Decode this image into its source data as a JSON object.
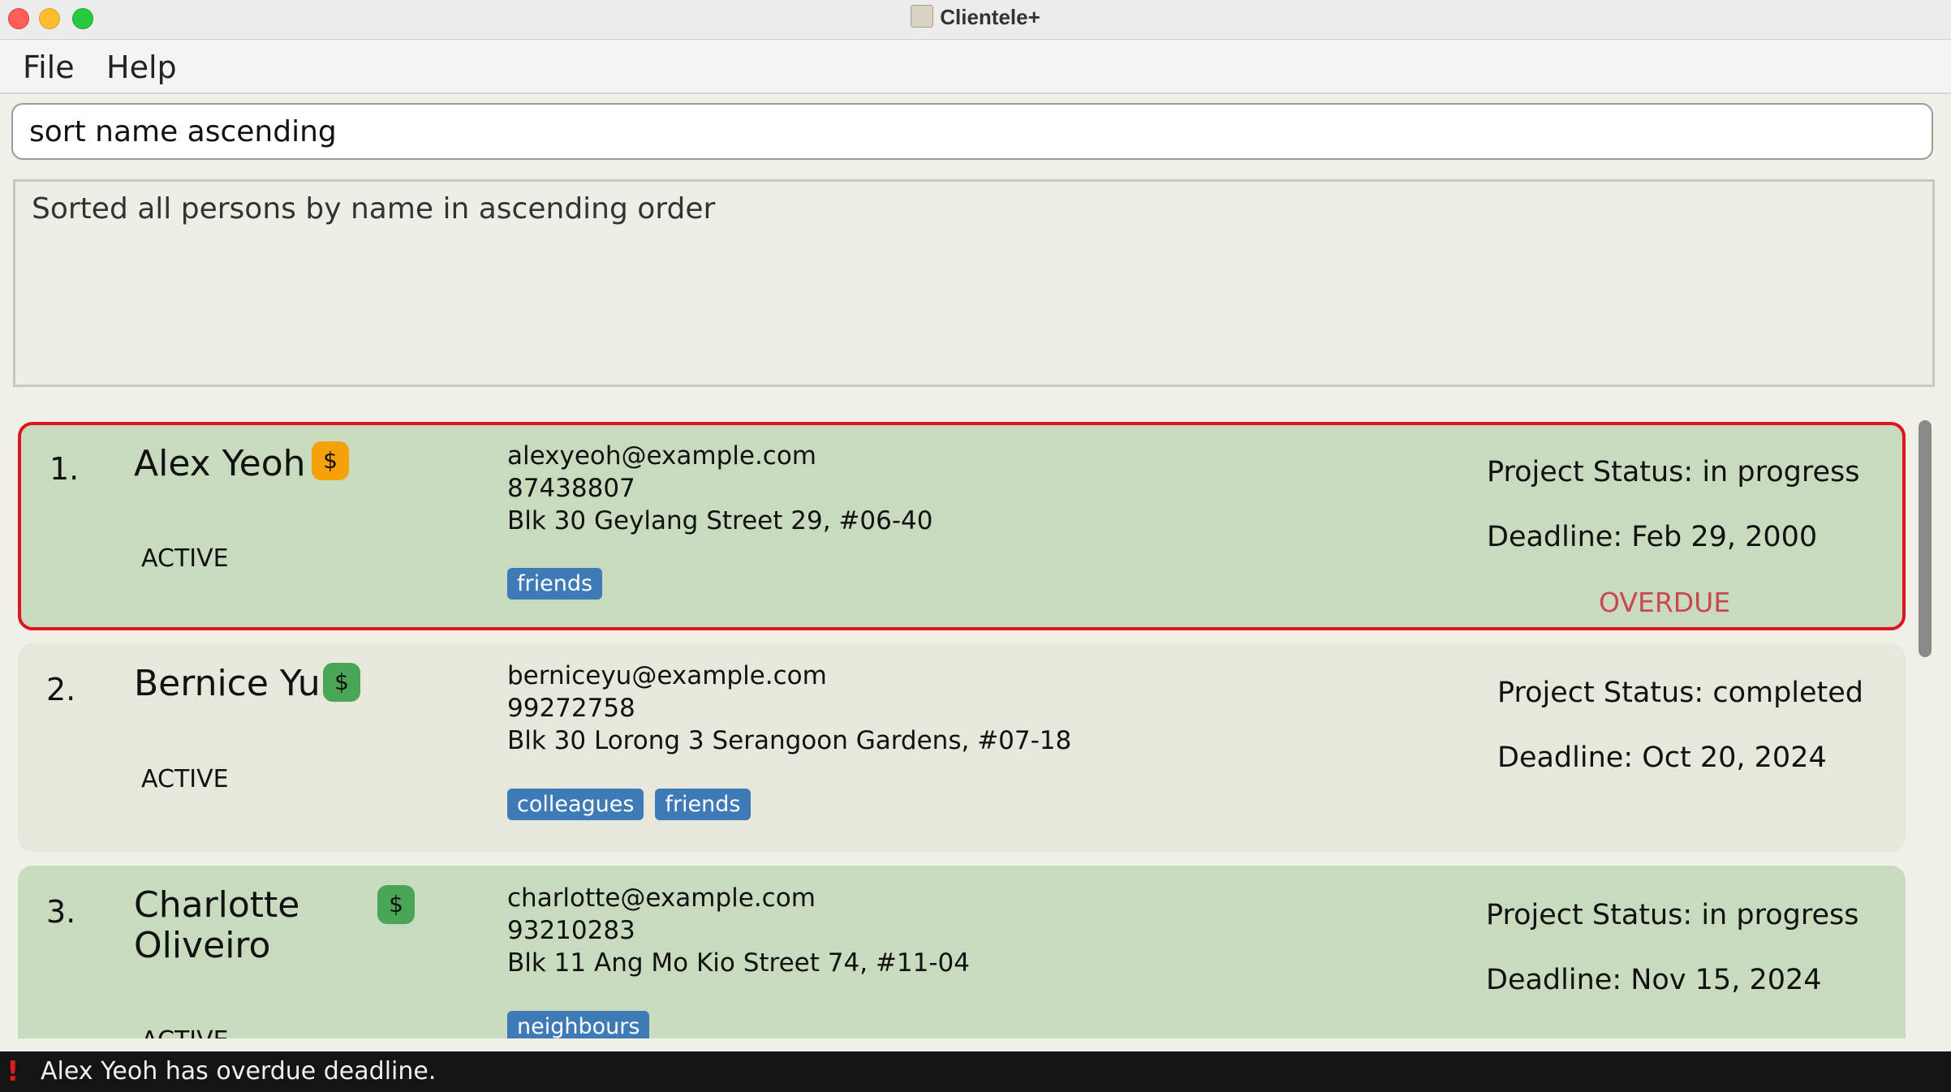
{
  "window": {
    "title": "Clientele+",
    "icon": "address-book-icon"
  },
  "menu": {
    "items": [
      "File",
      "Help"
    ]
  },
  "command": {
    "value": "sort name ascending"
  },
  "result": {
    "text": "Sorted all persons by name in ascending order"
  },
  "persons": [
    {
      "index": "1.",
      "name": "Alex Yeoh",
      "payment_icon": "dollar-icon",
      "payment_color": "#f5a20a",
      "status": "ACTIVE",
      "email": "alexyeoh@example.com",
      "phone": "87438807",
      "address": "Blk 30 Geylang Street 29, #06-40",
      "tags": [
        "friends"
      ],
      "project_status": "Project Status: in progress",
      "deadline": "Deadline: Feb 29, 2000",
      "overdue": "OVERDUE"
    },
    {
      "index": "2.",
      "name": "Bernice Yu",
      "payment_icon": "dollar-icon",
      "payment_color": "#4aa657",
      "status": "ACTIVE",
      "email": "berniceyu@example.com",
      "phone": "99272758",
      "address": "Blk 30 Lorong 3 Serangoon Gardens, #07-18",
      "tags": [
        "colleagues",
        "friends"
      ],
      "project_status": "Project Status: completed",
      "deadline": "Deadline: Oct 20, 2024"
    },
    {
      "index": "3.",
      "name_line1": "Charlotte",
      "name_line2": "Oliveiro",
      "payment_icon": "dollar-icon",
      "payment_color": "#4aa657",
      "status": "ACTIVE",
      "email": "charlotte@example.com",
      "phone": "93210283",
      "address": "Blk 11 Ang Mo Kio Street 74, #11-04",
      "tags": [
        "neighbours"
      ],
      "project_status": "Project Status: in progress",
      "deadline": "Deadline: Nov 15, 2024"
    }
  ],
  "statusbar": {
    "icon": "warning-icon",
    "text": "Alex Yeoh has overdue deadline."
  }
}
